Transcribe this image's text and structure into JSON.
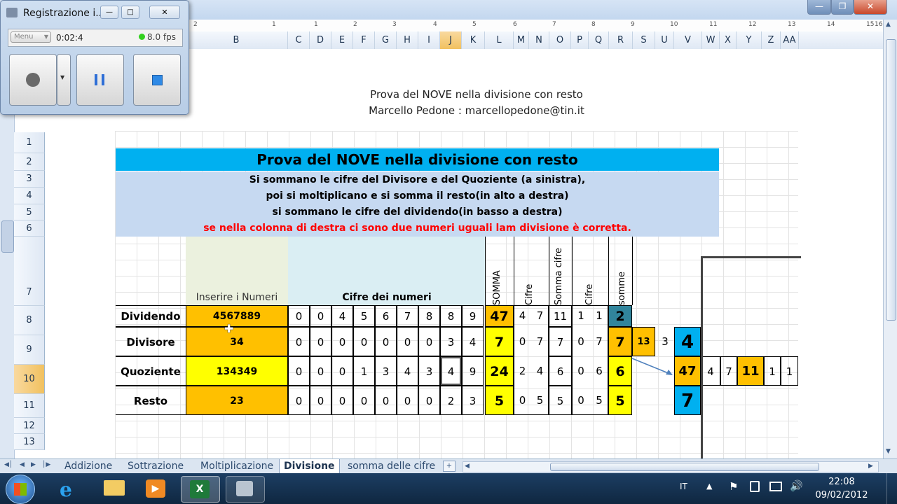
{
  "recorder": {
    "title": "Registrazione i...",
    "menu_label": "Menu",
    "elapsed": "0:02:4",
    "fps": "8.0 fps"
  },
  "columns": [
    "B",
    "C",
    "D",
    "E",
    "F",
    "G",
    "H",
    "I",
    "J",
    "K",
    "L",
    "M",
    "N",
    "O",
    "P",
    "Q",
    "R",
    "S",
    "U",
    "V",
    "W",
    "X",
    "Y",
    "Z",
    "AA"
  ],
  "selected_column": "J",
  "ruler_ticks": [
    "2",
    "1",
    "1",
    "2",
    "3",
    "4",
    "5",
    "6",
    "7",
    "8",
    "9",
    "10",
    "11",
    "12",
    "13",
    "14",
    "15",
    "16"
  ],
  "rows": [
    "1",
    "2",
    "3",
    "4",
    "5",
    "6",
    "7",
    "8",
    "9",
    "10",
    "11",
    "12",
    "13"
  ],
  "selected_row": "10",
  "header": {
    "line1": "Prova del NOVE nella divisione con resto",
    "line2": "Marcello Pedone : marcellopedone@tin.it"
  },
  "banner_title": "Prova del NOVE nella divisione con resto",
  "instructions": [
    "Si sommano  le cifre del Divisore e del Quoziente (a sinistra),",
    "poi si moltiplicano e si somma il resto(in alto a destra)",
    "si sommano le cifre del dividendo(in basso a destra)"
  ],
  "instruction_red": "se nella colonna di destra ci sono due numeri uguali lam divisione è corretta.",
  "col_labels": {
    "input": "Inserire i Numeri",
    "digits": "Cifre dei numeri",
    "somma": "SOMMA",
    "cifre1": "Cifre",
    "somma_cifre": "Somma cifre",
    "cifre2": "Cifre",
    "somme": "somme"
  },
  "table": [
    {
      "label": "Dividendo",
      "value": "4567889",
      "digits": [
        "0",
        "0",
        "4",
        "5",
        "6",
        "7",
        "8",
        "8",
        "9"
      ],
      "somma": "47",
      "c1": "4",
      "c2": "7",
      "sc": "11",
      "c3": "1",
      "c4": "1",
      "somme": "2"
    },
    {
      "label": "Divisore",
      "value": "34",
      "digits": [
        "0",
        "0",
        "0",
        "0",
        "0",
        "0",
        "0",
        "3",
        "4"
      ],
      "somma": "7",
      "c1": "0",
      "c2": "7",
      "sc": "7",
      "c3": "0",
      "c4": "7",
      "somme": "7"
    },
    {
      "label": "Quoziente",
      "value": "134349",
      "digits": [
        "0",
        "0",
        "0",
        "1",
        "3",
        "4",
        "3",
        "4",
        "9"
      ],
      "somma": "24",
      "c1": "2",
      "c2": "4",
      "sc": "6",
      "c3": "0",
      "c4": "6",
      "somme": "6"
    },
    {
      "label": "Resto",
      "value": "23",
      "digits": [
        "0",
        "0",
        "0",
        "0",
        "0",
        "0",
        "0",
        "2",
        "3"
      ],
      "somma": "5",
      "c1": "0",
      "c2": "5",
      "sc": "5",
      "c3": "0",
      "c4": "5",
      "somme": "5"
    }
  ],
  "side": {
    "r9_a": "13",
    "r9_b": "3",
    "r9_c": "4",
    "r10_a": "47",
    "r10_b": "4",
    "r10_c": "7",
    "r10_d": "11",
    "r10_e": "1",
    "r10_f": "1",
    "r11_a": "7"
  },
  "sheet_tabs": [
    "Addizione",
    "Sottrazione",
    "Moltiplicazione",
    "Divisione",
    "somma delle cifre"
  ],
  "active_tab": "Divisione",
  "tray": {
    "lang": "IT",
    "time": "22:08",
    "date": "09/02/2012"
  },
  "colors": {
    "banner": "#00b0f0",
    "instructions_bg": "#c6d9f1",
    "orange": "#ffc000",
    "yellow": "#ffff00",
    "red_text": "#ff0000",
    "teal": "#31859c"
  }
}
